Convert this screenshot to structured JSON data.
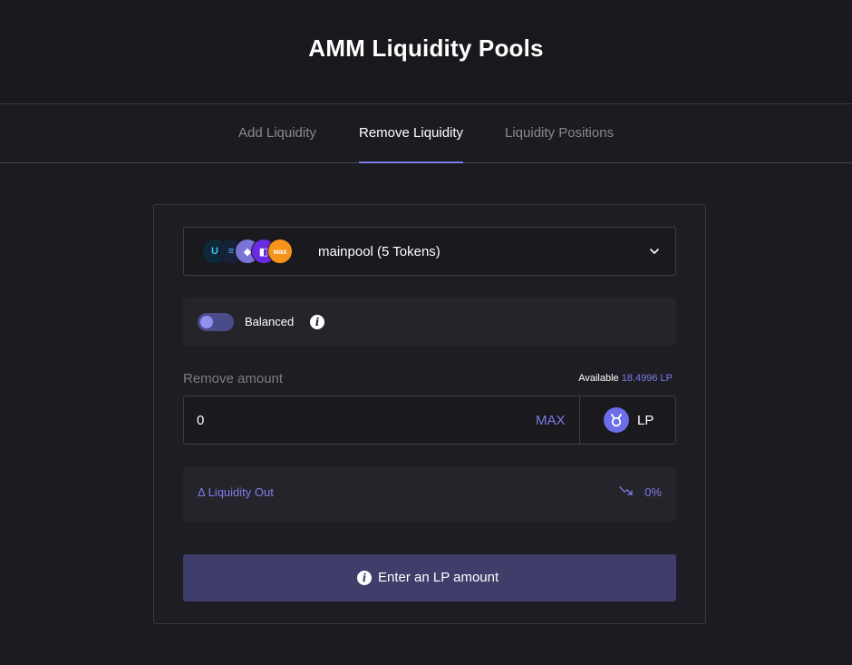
{
  "header": {
    "title": "AMM Liquidity Pools"
  },
  "tabs": [
    {
      "label": "Add Liquidity",
      "active": false
    },
    {
      "label": "Remove Liquidity",
      "active": true
    },
    {
      "label": "Liquidity Positions",
      "active": false
    }
  ],
  "pool": {
    "name": "mainpool (5 Tokens)",
    "tokens": [
      {
        "icon": "usn-token-icon",
        "glyph": "U",
        "bg": "#0e2a3a",
        "fg": "#35c7e8"
      },
      {
        "icon": "stable-token-icon",
        "glyph": "≡",
        "bg": "#16213a",
        "fg": "#5fb3ff"
      },
      {
        "icon": "eth-token-icon",
        "glyph": "◆",
        "bg": "#7a74d6",
        "fg": "#ffffff"
      },
      {
        "icon": "purple-token-icon",
        "glyph": "◧",
        "bg": "#6a2be0",
        "fg": "#ffffff"
      },
      {
        "icon": "wax-token-icon",
        "glyph": "wax",
        "bg": "#f7931a",
        "fg": "#ffffff"
      }
    ]
  },
  "balanced": {
    "label": "Balanced",
    "enabled": true
  },
  "remove": {
    "label": "Remove amount",
    "available_label": "Available",
    "available_value": "18.4996 LP",
    "amount_value": "0",
    "max_label": "MAX",
    "token_label": "LP"
  },
  "liquidity_out": {
    "label": "Δ Liquidity Out",
    "value": "0%"
  },
  "submit": {
    "label": "Enter an LP amount"
  },
  "colors": {
    "accent": "#7b7de8",
    "background": "#1c1b20",
    "button": "#3f3e6a"
  }
}
